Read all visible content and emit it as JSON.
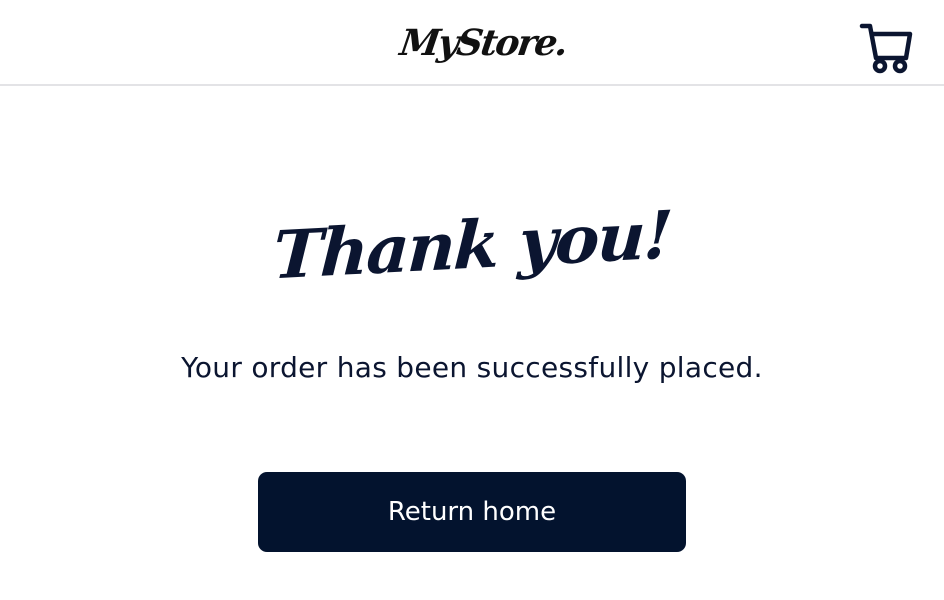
{
  "header": {
    "logo_text": "MyStore.",
    "cart_icon": "shopping-cart-icon"
  },
  "main": {
    "heading": "Thank you!",
    "message": "Your order has been successfully placed.",
    "button_label": "Return home"
  },
  "colors": {
    "primary": "#03132e",
    "text": "#0b1530",
    "divider": "#e3e3e6",
    "background": "#ffffff"
  }
}
